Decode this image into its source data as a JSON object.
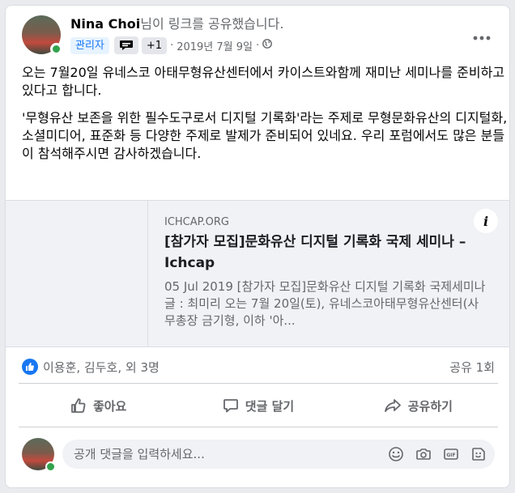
{
  "post": {
    "author": "Nina Choi",
    "author_suffix": "님이 링크를 공유했습니다.",
    "badge_admin": "관리자",
    "badge_extra": "+1",
    "date": "2019년 7월 9일",
    "meta_sep": "·",
    "audience_icon": "globe-icon",
    "paragraph1": "오는 7월20일 유네스코 아태무형유산센터에서 카이스트와함께 재미난 세미나를 준비하고 있다고 합니다.",
    "paragraph2": "'무형유산 보존을 위한 필수도구로서 디지털 기록화'라는 주제로 무형문화유산의 디지털화,소셜미디어, 표준화 등 다양한 주제로 발제가 준비되어 있네요. 우리 포럼에서도 많은 분들이 참석해주시면 감사하겠습니다."
  },
  "link": {
    "domain": "ICHCAP.ORG",
    "title": "[참가자 모집]문화유산 디지털 기록화 국제 세미나 – Ichcap",
    "description": "05 Jul 2019 [참가자 모집]문화유산 디지털 기록화 국제세미나 글 : 최미리 오는 7월 20일(토), 유네스코아태무형유산센터(사무총장 금기형, 이하 '아...",
    "info_label": "i"
  },
  "reactions": {
    "names": "이용훈, 김두호, 외 3명",
    "shares": "공유 1회"
  },
  "actions": {
    "like": "좋아요",
    "comment": "댓글 달기",
    "share": "공유하기"
  },
  "comment": {
    "placeholder": "공개 댓글을 입력하세요..."
  },
  "colors": {
    "accent": "#1877f2",
    "online": "#31a24c",
    "secondary_text": "#65676b"
  }
}
